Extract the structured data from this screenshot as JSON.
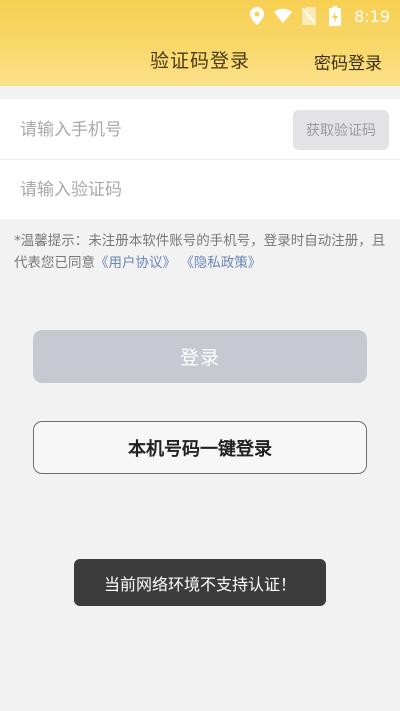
{
  "status_bar": {
    "time": "8:19",
    "icons": [
      "location-icon",
      "wifi-icon",
      "no-sim-icon",
      "battery-charging-icon"
    ]
  },
  "header": {
    "title": "验证码登录",
    "right_action": "密码登录",
    "color_top": "#f7cf52",
    "color_bottom": "#fbe08a"
  },
  "form": {
    "phone_placeholder": "请输入手机号",
    "code_placeholder": "请输入验证码",
    "get_code_label": "获取验证码"
  },
  "tip": {
    "text": "*温馨提示：未注册本软件账号的手机号，登录时自动注册，且代表您已同意",
    "user_agreement": "《用户协议》",
    "privacy_policy": "《隐私政策》"
  },
  "buttons": {
    "login": "登录",
    "one_key_login": "本机号码一键登录"
  },
  "toast": {
    "message": "当前网络环境不支持认证！"
  }
}
